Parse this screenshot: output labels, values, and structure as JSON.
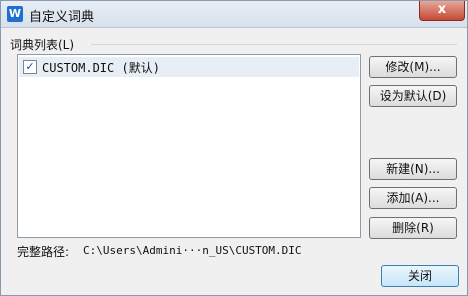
{
  "window": {
    "title": "自定义词典",
    "app_icon_letter": "W",
    "close_glyph": "x"
  },
  "group": {
    "label": "词典列表(L)"
  },
  "dictionary_list": [
    {
      "checked": true,
      "check_glyph": "✓",
      "label": "CUSTOM.DIC (默认)"
    }
  ],
  "buttons": {
    "modify": "修改(M)...",
    "set_default": "设为默认(D)",
    "new": "新建(N)...",
    "add": "添加(A)...",
    "delete": "删除(R)",
    "close": "关闭"
  },
  "path": {
    "label": "完整路径:",
    "value": "C:\\Users\\Admini···n_US\\CUSTOM.DIC"
  },
  "colors": {
    "title_close": "#c44a34",
    "selection": "#e8eef6",
    "accent": "#1e6fd2"
  }
}
